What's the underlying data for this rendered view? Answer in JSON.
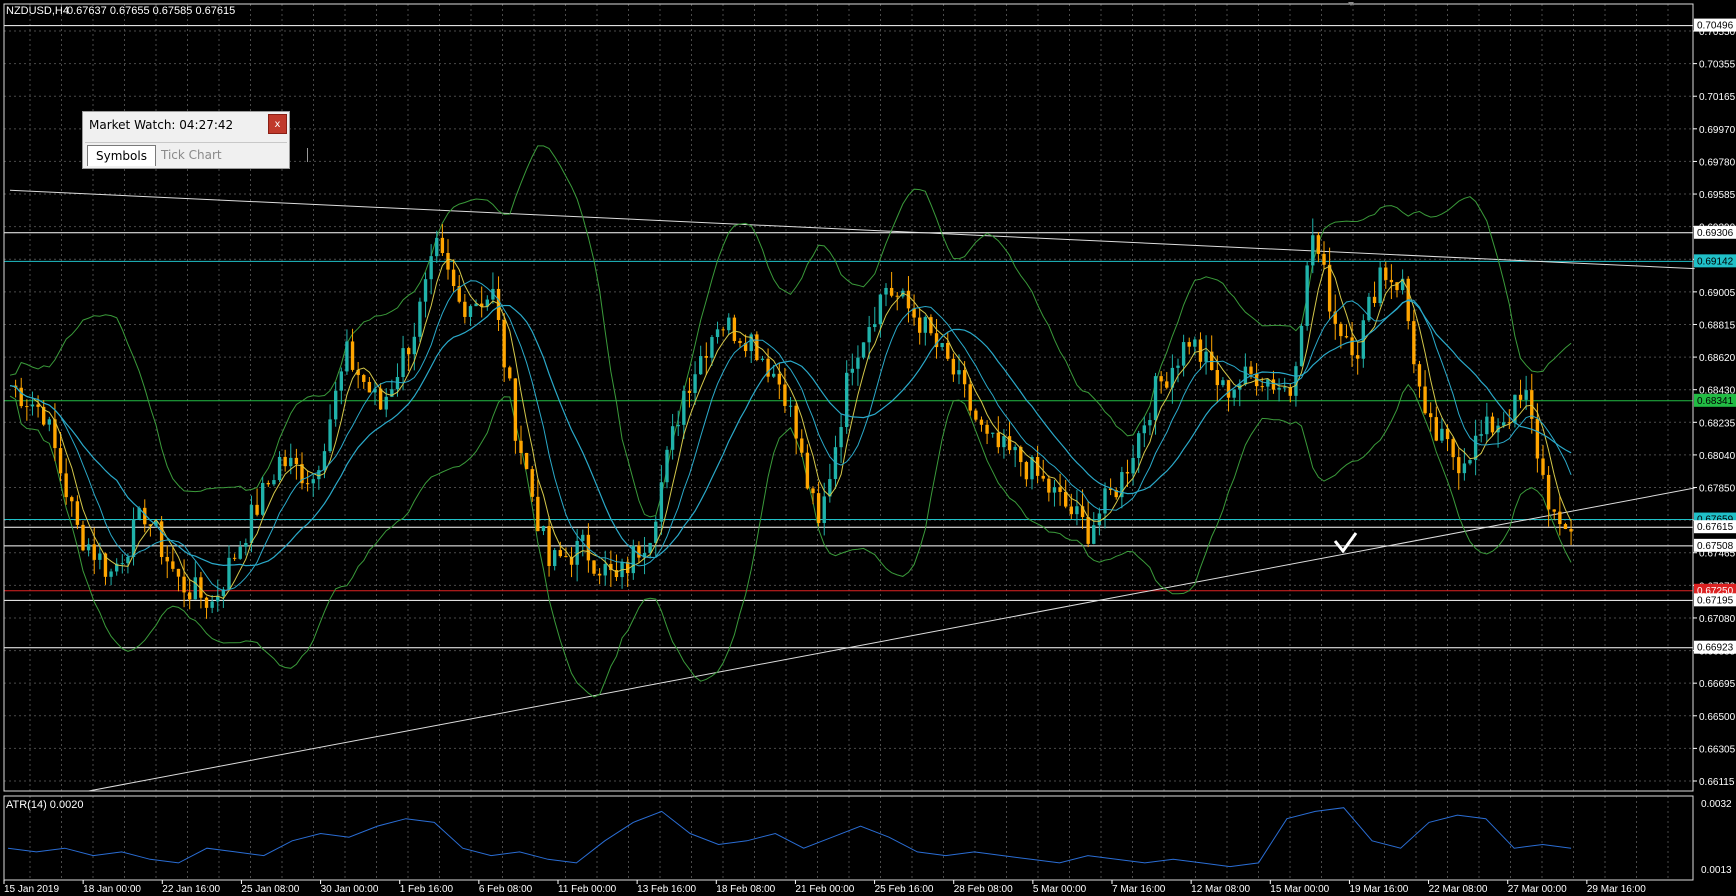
{
  "chart_header": {
    "symbol": "NZDUSD,H4",
    "ohlc": "0.67637 0.67655 0.67585 0.67615"
  },
  "colors": {
    "background": "#000000",
    "grid": "#4a4a4a",
    "bull_candle": "#20b2aa",
    "bear_candle": "#ffa500",
    "bollinger": "#3a9a3a",
    "ma_fast": "#d4c84a",
    "ma_slow": "#2aa9c9",
    "atr_line": "#2a6dd4",
    "level_cyan": "#20c0c8",
    "level_green": "#22bb44",
    "level_red": "#dd2222",
    "level_white": "#ffffff"
  },
  "market_watch": {
    "title": "Market Watch: 04:27:42",
    "close_label": "x",
    "tabs": [
      "Symbols",
      "Tick Chart"
    ],
    "active_tab": "Symbols"
  },
  "price_axis": {
    "labels": [
      "0.70550",
      "0.70355",
      "0.70165",
      "0.69970",
      "0.69780",
      "0.69585",
      "0.69390",
      "0.69200",
      "0.69005",
      "0.68815",
      "0.68620",
      "0.68430",
      "0.68235",
      "0.68040",
      "0.67850",
      "0.67655",
      "0.67465",
      "0.67270",
      "0.67080",
      "0.66885",
      "0.66695",
      "0.66500",
      "0.66305",
      "0.66115"
    ],
    "highlighted": [
      {
        "value": "0.70496",
        "style": "white"
      },
      {
        "value": "0.69306",
        "style": "white"
      },
      {
        "value": "0.69142",
        "style": "cyan"
      },
      {
        "value": "0.68341",
        "style": "green"
      },
      {
        "value": "0.67659",
        "style": "cyan"
      },
      {
        "value": "0.67615",
        "style": "white"
      },
      {
        "value": "0.67508",
        "style": "white"
      },
      {
        "value": "0.67250",
        "style": "red"
      },
      {
        "value": "0.67195",
        "style": "white"
      },
      {
        "value": "0.66923",
        "style": "white"
      }
    ]
  },
  "time_axis": {
    "labels": [
      "15 Jan 2019",
      "18 Jan 00:00",
      "22 Jan 16:00",
      "25 Jan 08:00",
      "30 Jan 00:00",
      "1 Feb 16:00",
      "6 Feb 08:00",
      "11 Feb 00:00",
      "13 Feb 16:00",
      "18 Feb 08:00",
      "21 Feb 00:00",
      "25 Feb 16:00",
      "28 Feb 08:00",
      "5 Mar 00:00",
      "7 Mar 16:00",
      "12 Mar 08:00",
      "15 Mar 00:00",
      "19 Mar 16:00",
      "22 Mar 08:00",
      "27 Mar 00:00",
      "29 Mar 16:00"
    ]
  },
  "atr": {
    "label": "ATR(14) 0.0020",
    "axis_top": "0.0032",
    "axis_bottom": "0.0013"
  },
  "chart_data": {
    "type": "candlestick",
    "title": "NZDUSD,H4",
    "ylim": [
      0.661,
      0.7062
    ],
    "x_count": 300,
    "price_path": [
      [
        0,
        0.6843
      ],
      [
        6,
        0.6828
      ],
      [
        12,
        0.676
      ],
      [
        18,
        0.6735
      ],
      [
        24,
        0.677
      ],
      [
        30,
        0.673
      ],
      [
        36,
        0.6718
      ],
      [
        42,
        0.676
      ],
      [
        48,
        0.68
      ],
      [
        54,
        0.679
      ],
      [
        60,
        0.686
      ],
      [
        66,
        0.683
      ],
      [
        72,
        0.6875
      ],
      [
        76,
        0.692
      ],
      [
        80,
        0.689
      ],
      [
        86,
        0.6895
      ],
      [
        90,
        0.682
      ],
      [
        96,
        0.674
      ],
      [
        102,
        0.675
      ],
      [
        108,
        0.673
      ],
      [
        114,
        0.676
      ],
      [
        120,
        0.684
      ],
      [
        126,
        0.688
      ],
      [
        132,
        0.687
      ],
      [
        138,
        0.684
      ],
      [
        144,
        0.676
      ],
      [
        150,
        0.686
      ],
      [
        156,
        0.69
      ],
      [
        162,
        0.688
      ],
      [
        168,
        0.685
      ],
      [
        174,
        0.681
      ],
      [
        180,
        0.68
      ],
      [
        186,
        0.678
      ],
      [
        192,
        0.676
      ],
      [
        198,
        0.679
      ],
      [
        204,
        0.684
      ],
      [
        210,
        0.687
      ],
      [
        216,
        0.684
      ],
      [
        222,
        0.685
      ],
      [
        228,
        0.684
      ],
      [
        232,
        0.693
      ],
      [
        236,
        0.688
      ],
      [
        240,
        0.6865
      ],
      [
        244,
        0.691
      ],
      [
        248,
        0.69
      ],
      [
        252,
        0.682
      ],
      [
        258,
        0.68
      ],
      [
        264,
        0.682
      ],
      [
        270,
        0.6835
      ],
      [
        273,
        0.679
      ],
      [
        276,
        0.6755
      ],
      [
        278,
        0.6762
      ]
    ],
    "levels": [
      0.70496,
      0.69306,
      0.69142,
      0.68341,
      0.67659,
      0.67615,
      0.67508,
      0.6725,
      0.67195,
      0.66923
    ],
    "trendlines": [
      {
        "name": "upper-trendline",
        "from": [
          0,
          0.6955
        ],
        "to": [
          300,
          0.691
        ]
      },
      {
        "name": "lower-trendline",
        "from": [
          14,
          0.661
        ],
        "to": [
          300,
          0.6784
        ]
      }
    ],
    "atr_series": [
      0.002,
      0.0019,
      0.002,
      0.0018,
      0.0019,
      0.0017,
      0.0016,
      0.002,
      0.0019,
      0.0018,
      0.0022,
      0.0024,
      0.0023,
      0.0026,
      0.0028,
      0.0027,
      0.002,
      0.0018,
      0.0019,
      0.0017,
      0.0016,
      0.0022,
      0.0027,
      0.003,
      0.0024,
      0.0021,
      0.0022,
      0.0024,
      0.002,
      0.0023,
      0.0026,
      0.0023,
      0.0019,
      0.0018,
      0.0019,
      0.0018,
      0.0017,
      0.0016,
      0.0018,
      0.0017,
      0.0016,
      0.0017,
      0.0016,
      0.0015,
      0.0016,
      0.0028,
      0.003,
      0.0031,
      0.0022,
      0.002,
      0.0027,
      0.0029,
      0.0028,
      0.002,
      0.0021,
      0.002
    ]
  }
}
